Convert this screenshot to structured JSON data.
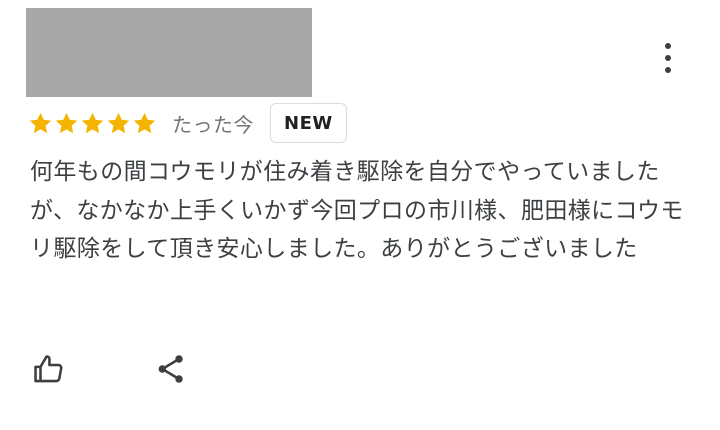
{
  "reviewer": {
    "name_redacted": true
  },
  "rating": {
    "stars": 5,
    "max": 5,
    "star_color": "#f4b400"
  },
  "meta": {
    "time": "たった今",
    "badge": "NEW"
  },
  "review": {
    "text": "何年もの間コウモリが住み着き駆除を自分でやっていましたが、なかなか上手くいかず今回プロの市川様、肥田様にコウモリ駆除をして頂き安心しました。ありがとうございました"
  },
  "actions": {
    "more_icon": "more-vertical-icon",
    "like_icon": "thumbs-up-icon",
    "share_icon": "share-icon"
  },
  "colors": {
    "text": "#3c4043",
    "secondary_text": "#70757a",
    "redaction": "#a8a8a8"
  }
}
